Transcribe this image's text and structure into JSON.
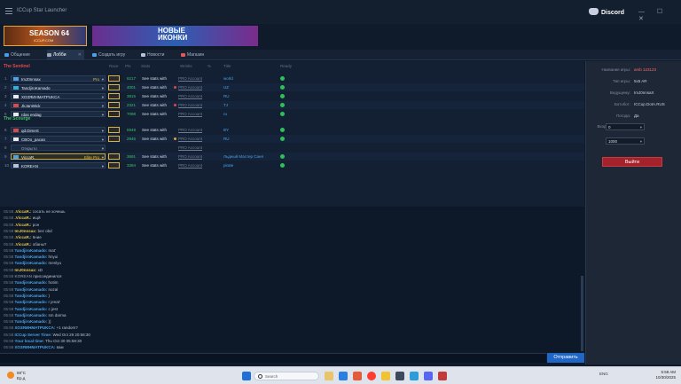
{
  "window": {
    "title": "ICCup Star Launcher",
    "discord_label": "Discord",
    "controls": "— ☐ ✕"
  },
  "banners": {
    "season_title": "SEASON 64",
    "season_sub": "ICCUP.COM",
    "icons_title": "НОВЫЕ\nИКОНКИ"
  },
  "tabs": [
    {
      "label": "Общение",
      "color": "#4a9be8"
    },
    {
      "label": "Лобби",
      "color": "#9aa7ba",
      "close": "✕"
    },
    {
      "label": "Создать игру",
      "color": "#4aa3e8"
    },
    {
      "label": "Новости",
      "color": "#b9c4d4"
    },
    {
      "label": "Магазин",
      "color": "#e05a5a"
    }
  ],
  "lobby": {
    "headers": {
      "race": "Race",
      "pts": "Pts",
      "stats": "Stats",
      "wins": "Wrinks",
      "pct": "%",
      "title": "Title",
      "ready": "Ready"
    },
    "sentinel_label": "The Sentinel",
    "scourge_label": "The Scourge",
    "stats_text": "See stats with",
    "account_text": "PRO Account",
    "sentinel": [
      {
        "num": "1",
        "name": "ImJ0nnsax",
        "tag": "Pro",
        "rank": "6217",
        "country": "world",
        "flag": "#4aa3e8",
        "dot": "",
        "ready": true
      },
      {
        "num": "2",
        "name": "TandjiroKamado",
        "tag": "",
        "rank": "4001",
        "country": "UZ",
        "flag": "#2fb0e0",
        "dot": "#e04848",
        "ready": true
      },
      {
        "num": "3",
        "name": "ХОЗЯИНМАТРUKСA",
        "tag": "",
        "rank": "3815",
        "country": "RU",
        "flag": "#e8eaf0",
        "dot": "",
        "ready": true
      },
      {
        "num": "4",
        "name": "JkJanWick",
        "tag": "",
        "rank": "2321",
        "country": "TJ",
        "flag": "#e04848",
        "dot": "#e04848",
        "ready": true
      },
      {
        "num": "5",
        "name": "rdas endag",
        "tag": "",
        "rank": "7098",
        "country": "ru",
        "flag": "#e8eaf0",
        "dot": "",
        "ready": true
      }
    ],
    "scourge": [
      {
        "num": "6",
        "name": "qd.DimeS",
        "tag": "",
        "rank": "5948",
        "country": "BY",
        "flag": "#d84848",
        "dot": "",
        "ready": true
      },
      {
        "num": "7",
        "name": "CBOo_pacan",
        "tag": "",
        "rank": "2946",
        "country": "RU",
        "flag": "#e8eaf0",
        "dot": "#e0a040",
        "ready": true
      },
      {
        "num": "8",
        "name": "Открыто",
        "tag": "",
        "rank": "",
        "country": "",
        "flag": "",
        "dot": "",
        "ready": false,
        "open": true
      },
      {
        "num": "9",
        "name": "ViccaR.",
        "tag": "Elite Pro",
        "rank": "3691",
        "country": "Льдный Мастер Саня",
        "flag": "#4aa3e8",
        "dot": "",
        "ready": true,
        "me": true
      },
      {
        "num": "10",
        "name": "KOREAN",
        "tag": "",
        "rank": "3394",
        "country": "pirate",
        "flag": "#b9c4d4",
        "dot": "",
        "ready": true
      }
    ]
  },
  "game_info": {
    "fields": [
      {
        "key": "Название игры:",
        "value": "amb 123123",
        "red": true
      },
      {
        "key": "Тип игры:",
        "value": "5x5 AR"
      },
      {
        "key": "Ведущему:",
        "value": "ImJ0nnsaX"
      },
      {
        "key": "Ботобот:",
        "value": "ICCup.DotA.RUS"
      },
      {
        "key": "Погода:",
        "value": "Да"
      }
    ],
    "ping_label": "Входной пинг (%):",
    "ping_value": "0",
    "rank_label": "Ранг макет:",
    "rank_value": "1000",
    "exit_label": "Выйти"
  },
  "chat": {
    "lines": [
      {
        "time": "05:58",
        "name": ".ViccaR.:",
        "msg": "сосать не хочешь",
        "color": "#e8c34a"
      },
      {
        "time": "05:58",
        "name": ".ViccaR.:",
        "msg": "ищй",
        "color": "#e8c34a"
      },
      {
        "time": "05:58",
        "name": ".ViccaR.:",
        "msg": "рон",
        "color": "#e8c34a"
      },
      {
        "time": "05:58",
        "name": "ImJ0nnsax:",
        "msg": "bez obd",
        "color": "#e8c34a"
      },
      {
        "time": "05:58",
        "name": ".ViccaR.:",
        "msg": "5ние",
        "color": "#e8c34a"
      },
      {
        "time": "05:58",
        "name": ".ViccaR.:",
        "msg": "обаны?",
        "color": "#e8c34a"
      },
      {
        "time": "05:58",
        "name": "TandjiroKamado:",
        "msg": "mat'",
        "color": "#4aa3e8"
      },
      {
        "time": "05:58",
        "name": "TandjiroKamado:",
        "msg": "hnyui",
        "color": "#4aa3e8"
      },
      {
        "time": "05:58",
        "name": "TandjiroKamado:",
        "msg": "menlyu",
        "color": "#4aa3e8"
      },
      {
        "time": "05:58",
        "name": "ImJ0nnsax:",
        "msg": "xD",
        "color": "#e8c34a"
      },
      {
        "time": "05:58",
        "name": "KOREAN",
        "msg": "присоединился",
        "color": "#6f7c90"
      },
      {
        "time": "05:58",
        "name": "TandjiroKamado:",
        "msg": "hotim",
        "color": "#4aa3e8"
      },
      {
        "time": "05:58",
        "name": "TandjiroKamado:",
        "msg": "nozal",
        "color": "#4aa3e8"
      },
      {
        "time": "05:58",
        "name": "TandjiroKamado:",
        "msg": ")",
        "color": "#4aa3e8"
      },
      {
        "time": "05:58",
        "name": "TandjiroKamado:",
        "msg": "r jenat'",
        "color": "#4aa3e8"
      },
      {
        "time": "05:58",
        "name": "TandjiroKamado:",
        "msg": "c jest",
        "color": "#4aa3e8"
      },
      {
        "time": "05:58",
        "name": "TandjiroKamado:",
        "msg": "sm darma",
        "color": "#4aa3e8"
      },
      {
        "time": "05:58",
        "name": "TandjiroKamado:",
        "msg": "))",
        "color": "#4aa3e8"
      },
      {
        "time": "05:58",
        "name": "ХОЗЯИНМАТРUKСA:",
        "msg": "+1 random?",
        "color": "#4aa3e8"
      },
      {
        "time": "05:58",
        "name": "ICCup Server Time:",
        "msg": "Wed Oct 29 20:58:30",
        "color": "#4aa3e8"
      },
      {
        "time": "05:58",
        "name": "Your local time:",
        "msg": "Thu Oct 30 05:58:30",
        "color": "#4aa3e8"
      },
      {
        "time": "05:58",
        "name": "ХОЗЯИНМАТРUKСA:",
        "msg": "вам",
        "color": "#4aa3e8"
      }
    ],
    "send_label": "Отправить"
  },
  "taskbar": {
    "weather_temp": "59°C",
    "weather_desc": "Ер.д",
    "search_placeholder": "Search",
    "tray": "ENG",
    "time": "5:58 AM",
    "date": "10/30/2025"
  }
}
